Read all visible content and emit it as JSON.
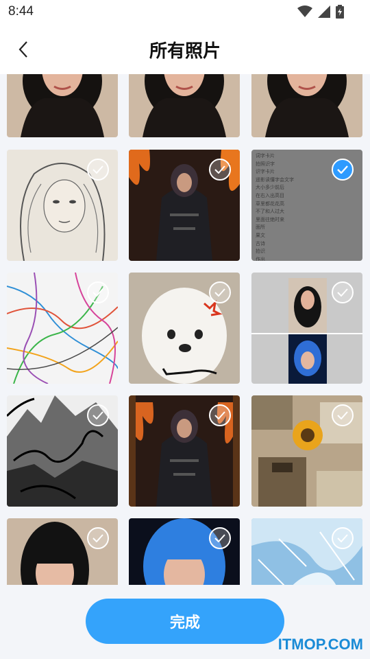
{
  "status": {
    "time": "8:44"
  },
  "header": {
    "title": "所有照片"
  },
  "footer": {
    "done_label": "完成"
  },
  "watermark": "ITMOP.COM",
  "list_screenshot_lines": [
    "词字卡片",
    "拍照识字",
    "识字卡片",
    "遥影读懂字会文字",
    "大小多少前后",
    "在右入出高目",
    "草里都花花高",
    "不了和人过大",
    "里面往绝时来",
    "面所",
    "果文",
    "古诗",
    "拍识",
    "作出"
  ],
  "colors": {
    "accent": "#34a3fb",
    "check_on": "#2e9bff"
  }
}
